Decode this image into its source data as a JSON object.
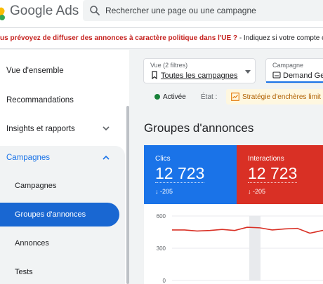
{
  "header": {
    "brand_google": "Google",
    "brand_ads": "Ads",
    "search_placeholder": "Rechercher une page ou une campagne"
  },
  "banner": {
    "question": "us prévoyez de diffuser des annonces à caractère politique dans l'UE ?",
    "text": " - Indiquez si votre compte comporte de"
  },
  "sidebar": {
    "items": [
      {
        "label": "Vue d'ensemble"
      },
      {
        "label": "Recommandations"
      },
      {
        "label": "Insights et rapports"
      }
    ],
    "campaigns": {
      "label": "Campagnes",
      "sub_items": [
        {
          "label": "Campagnes"
        },
        {
          "label": "Groupes d'annonces"
        },
        {
          "label": "Annonces"
        },
        {
          "label": "Tests"
        }
      ]
    }
  },
  "main": {
    "view_filter": {
      "small": "Vue (2 filtres)",
      "label": "Toutes les campagnes"
    },
    "campaign_filter": {
      "small": "Campagne",
      "label": "Demand Ge"
    },
    "status": {
      "label": "Activée",
      "etat": "État :",
      "strategy": "Stratégie d'enchères limit"
    },
    "title": "Groupes d'annonces",
    "metrics": [
      {
        "name": "Clics",
        "value": "12 723",
        "delta": "↓ -205"
      },
      {
        "name": "Interactions",
        "value": "12 723",
        "delta": "↓ -205"
      }
    ]
  },
  "colors": {
    "accent": "#1a73e8",
    "interactions": "#d93025",
    "active_status": "#188038"
  },
  "chart_data": {
    "type": "line",
    "y_ticks": [
      "600",
      "300",
      "0"
    ],
    "ylim": [
      0,
      600
    ],
    "series": [
      {
        "values": [
          470,
          470,
          460,
          465,
          475,
          465,
          495,
          490,
          470,
          480,
          485,
          440,
          465,
          470
        ]
      }
    ]
  }
}
